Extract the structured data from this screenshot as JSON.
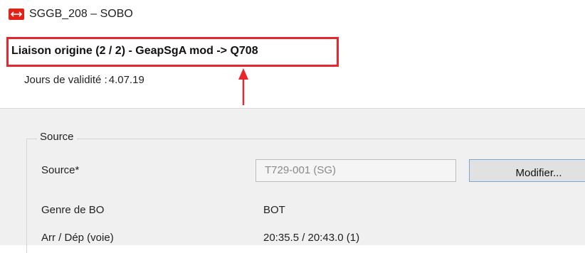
{
  "window": {
    "title": "SGGB_208 – SOBO",
    "icon": "sbb-logo-icon"
  },
  "header": {
    "liaison_title": "Liaison origine (2 / 2) - GeapSgA mod -> Q708",
    "validity_label": "Jours de validité :",
    "validity_value": "4.07.19",
    "highlight_color": "#e8262d"
  },
  "source_group": {
    "legend": "Source",
    "rows": [
      {
        "label": "Source*",
        "value": "T729-001 (SG)"
      },
      {
        "label": "Genre de BO",
        "value": "BOT"
      },
      {
        "label": "Arr / Dép (voie)",
        "value": "20:35.5 / 20:43.0 (1)"
      }
    ],
    "modify_button": "Modifier..."
  }
}
